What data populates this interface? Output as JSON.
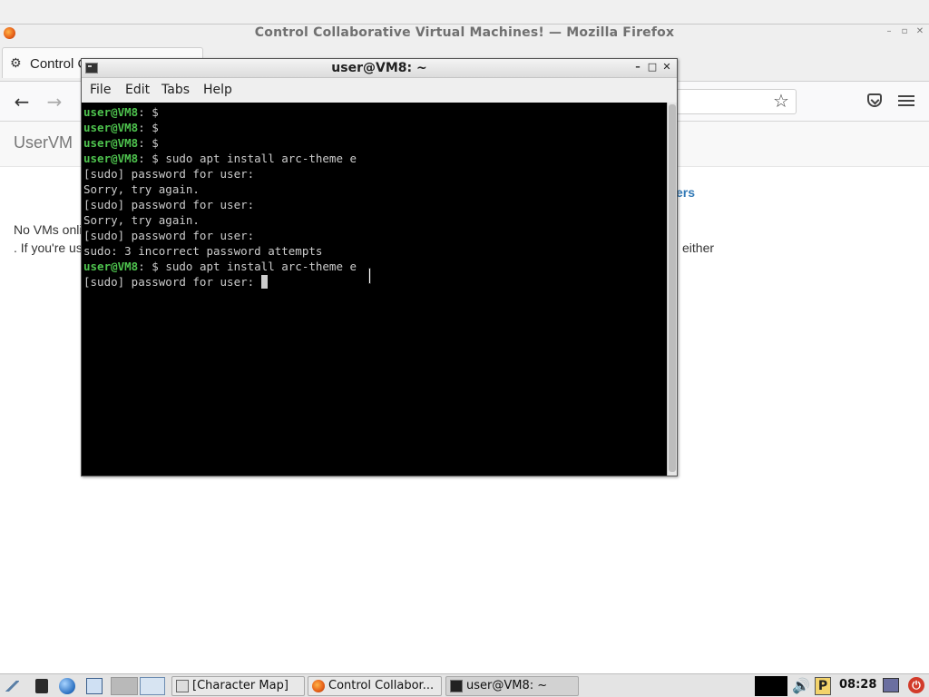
{
  "firefox": {
    "window_title": "Control Collaborative Virtual Machines! — Mozilla Firefox",
    "tab_label": "Control C",
    "page": {
      "brand": "UserVM",
      "partial_link": "ers",
      "no_vms_text": "No VMs onli",
      "if_youre_text": ". If you're us",
      "either_text": "either"
    }
  },
  "terminal": {
    "title": "user@VM8: ~",
    "menu": [
      "File",
      "Edit",
      "Tabs",
      "Help"
    ],
    "lines": [
      {
        "prompt_user": "user@VM8",
        "rest": ": $"
      },
      {
        "prompt_user": "user@VM8",
        "rest": ": $"
      },
      {
        "prompt_user": "user@VM8",
        "rest": ": $"
      },
      {
        "prompt_user": "user@VM8",
        "rest": ": $ sudo apt install arc-theme e"
      },
      {
        "prompt_user": "",
        "rest": "[sudo] password for user:"
      },
      {
        "prompt_user": "",
        "rest": "Sorry, try again."
      },
      {
        "prompt_user": "",
        "rest": "[sudo] password for user:"
      },
      {
        "prompt_user": "",
        "rest": "Sorry, try again."
      },
      {
        "prompt_user": "",
        "rest": "[sudo] password for user:"
      },
      {
        "prompt_user": "",
        "rest": "sudo: 3 incorrect password attempts"
      },
      {
        "prompt_user": "user@VM8",
        "rest": ": $ sudo apt install arc-theme e"
      },
      {
        "prompt_user": "",
        "rest": "[sudo] password for user: ",
        "cursor": true
      }
    ]
  },
  "taskbar": {
    "tasks": [
      {
        "label": "[Character Map]"
      },
      {
        "label": "Control Collabor..."
      },
      {
        "label": "user@VM8: ~"
      }
    ],
    "clock": "08:28",
    "p_label": "P"
  },
  "icons": {
    "back": "back-arrow-icon",
    "forward": "forward-arrow-icon",
    "bookmark": "star-icon",
    "pocket": "pocket-icon",
    "menu": "hamburger-menu-icon"
  }
}
